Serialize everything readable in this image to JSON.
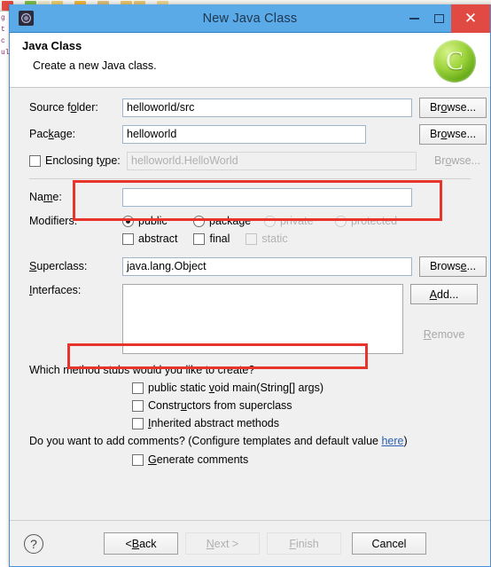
{
  "background": {
    "toolbar_icons": [
      "editor-icon",
      "dropdown-arrow",
      "debug-icon",
      "save-icon",
      "run-icon",
      "dropdown-arrow",
      "external-tools-icon",
      "dropdown-arrow",
      "search-icon",
      "dropdown-arrow",
      "folder-icon",
      "back-icon",
      "dropdown-arrow",
      "forward-icon",
      "dropdown-arrow"
    ],
    "editor_fragment": [
      "g",
      "t",
      "c",
      "ul",
      "!"
    ]
  },
  "window": {
    "title": "New Java Class",
    "icon": "java-class-wizard-icon",
    "minimize_label": "–",
    "maximize_label": "□",
    "close_label": "✕"
  },
  "header": {
    "title": "Java Class",
    "subtitle": "Create a new Java class.",
    "logo_letter": "C",
    "logo_name": "eclipse-wizard-banner-icon"
  },
  "form": {
    "source_folder": {
      "label": "Source folder:",
      "value": "helloworld/src",
      "button": "Browse...",
      "button_key": "o"
    },
    "package": {
      "label": "Package:",
      "value": "helloworld",
      "button": "Browse...",
      "button_key": "o"
    },
    "enclosing_type": {
      "label": "Enclosing type:",
      "value": "helloworld.HelloWorld",
      "checked": false,
      "enabled": false,
      "button": "Browse...",
      "button_key": "o"
    },
    "name": {
      "label": "Name:",
      "value": "",
      "placeholder": ""
    },
    "modifiers": {
      "label": "Modifiers:",
      "radios": [
        {
          "label": "public",
          "selected": true,
          "enabled": true
        },
        {
          "label": "package",
          "selected": false,
          "enabled": true
        },
        {
          "label": "private",
          "selected": false,
          "enabled": false
        },
        {
          "label": "protected",
          "selected": false,
          "enabled": false
        }
      ],
      "checkboxes": [
        {
          "label": "abstract",
          "checked": false,
          "enabled": true
        },
        {
          "label": "final",
          "checked": false,
          "enabled": true
        },
        {
          "label": "static",
          "checked": false,
          "enabled": false
        }
      ]
    },
    "superclass": {
      "label": "Superclass:",
      "value": "java.lang.Object",
      "button": "Browse...",
      "button_key": "e"
    },
    "interfaces": {
      "label": "Interfaces:",
      "items": [],
      "add_button": "Add...",
      "remove_button": "Remove",
      "remove_enabled": false
    },
    "method_stubs": {
      "question": "Which method stubs would you like to create?",
      "items": [
        {
          "label": "public static void main(String[] args)",
          "checked": false
        },
        {
          "label": "Constructors from superclass",
          "checked": false
        },
        {
          "label": "Inherited abstract methods",
          "checked": false
        }
      ]
    },
    "comments": {
      "question_prefix": "Do you want to add comments? (Configure templates and default value ",
      "link": "here",
      "question_suffix": ")",
      "checkbox": {
        "label": "Generate comments",
        "checked": false
      }
    }
  },
  "footer": {
    "help_icon": "?",
    "buttons": [
      {
        "name": "back",
        "label": "< Back",
        "enabled": true
      },
      {
        "name": "next",
        "label": "Next >",
        "enabled": false
      },
      {
        "name": "finish",
        "label": "Finish",
        "enabled": false
      },
      {
        "name": "cancel",
        "label": "Cancel",
        "enabled": true
      }
    ]
  },
  "annotations": {
    "highlight_color": "#e8352b",
    "boxes": [
      {
        "name": "name-field-highlight"
      },
      {
        "name": "main-method-highlight"
      }
    ]
  }
}
